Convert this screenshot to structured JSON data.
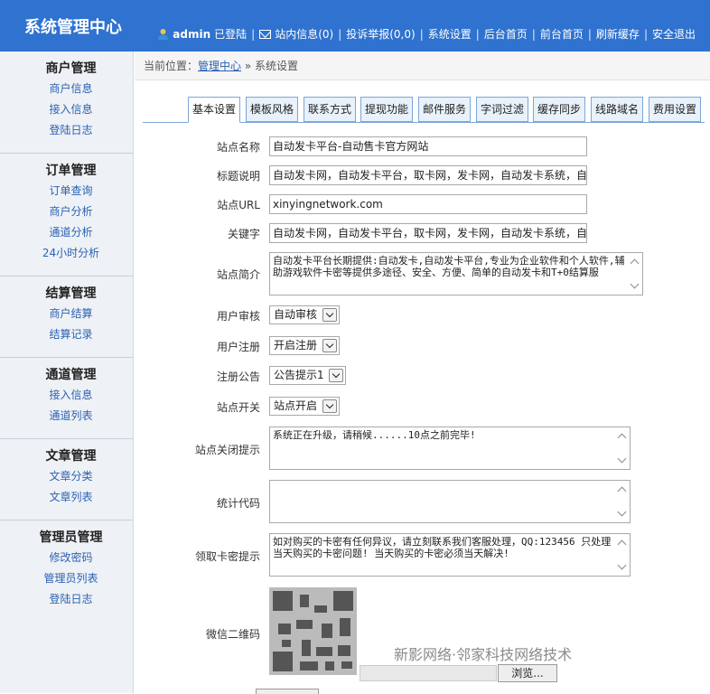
{
  "app": {
    "title": "系统管理中心"
  },
  "topnav": {
    "user": "admin",
    "logged_in": "已登陆",
    "messages": "站内信息(0)",
    "reports": "投诉举报(0,0)",
    "settings": "系统设置",
    "admin_home": "后台首页",
    "front_home": "前台首页",
    "refresh_cache": "刷新缓存",
    "logout": "安全退出",
    "sep": "|"
  },
  "sidebar": {
    "groups": [
      {
        "title": "商户管理",
        "items": [
          "商户信息",
          "接入信息",
          "登陆日志"
        ]
      },
      {
        "title": "订单管理",
        "items": [
          "订单查询",
          "商户分析",
          "通道分析",
          "24小时分析"
        ]
      },
      {
        "title": "结算管理",
        "items": [
          "商户结算",
          "结算记录"
        ]
      },
      {
        "title": "通道管理",
        "items": [
          "接入信息",
          "通道列表"
        ]
      },
      {
        "title": "文章管理",
        "items": [
          "文章分类",
          "文章列表"
        ]
      },
      {
        "title": "管理员管理",
        "items": [
          "修改密码",
          "管理员列表",
          "登陆日志"
        ]
      }
    ]
  },
  "breadcrumb": {
    "prefix": "当前位置：",
    "link": "管理中心",
    "current": "» 系统设置"
  },
  "tabs": [
    "基本设置",
    "模板风格",
    "联系方式",
    "提现功能",
    "邮件服务",
    "字词过滤",
    "缓存同步",
    "线路域名",
    "费用设置"
  ],
  "form": {
    "site_name": {
      "label": "站点名称",
      "value": "自动发卡平台-自动售卡官方网站"
    },
    "title_desc": {
      "label": "标题说明",
      "value": "自动发卡网，自动发卡平台，取卡网，发卡网，自动发卡系统，自"
    },
    "site_url": {
      "label": "站点URL",
      "value": "xinyingnetwork.com"
    },
    "keywords": {
      "label": "关键字",
      "value": "自动发卡网，自动发卡平台，取卡网，发卡网，自动发卡系统，自"
    },
    "site_intro": {
      "label": "站点简介",
      "value": "自动发卡平台长期提供:自动发卡,自动发卡平台,专业为企业软件和个人软件,辅助游戏软件卡密等提供多途径、安全、方便、简单的自动发卡和T+0结算服"
    },
    "user_review": {
      "label": "用户审核",
      "value": "自动审核"
    },
    "user_register": {
      "label": "用户注册",
      "value": "开启注册"
    },
    "register_notice": {
      "label": "注册公告",
      "value": "公告提示1"
    },
    "site_switch": {
      "label": "站点开关",
      "value": "站点开启"
    },
    "close_tip": {
      "label": "站点关闭提示",
      "value": "系统正在升级，请稍候......10点之前完毕!"
    },
    "stats_code": {
      "label": "统计代码",
      "value": ""
    },
    "card_tip": {
      "label": "领取卡密提示",
      "value": "如对购买的卡密有任何异议，请立刻联系我们客服处理，QQ:123456 只处理当天购买的卡密问题! 当天购买的卡密必须当天解决!"
    },
    "wechat_qr": {
      "label": "微信二维码"
    }
  },
  "watermark": "新影网络·邻家科技网络技术",
  "browse_button": "浏览...",
  "colors": {
    "header": "#2f72cf",
    "link": "#2b62b5",
    "tab_border": "#7aa7d9"
  },
  "icons": {
    "user": "user-icon",
    "mail": "mail-icon"
  }
}
